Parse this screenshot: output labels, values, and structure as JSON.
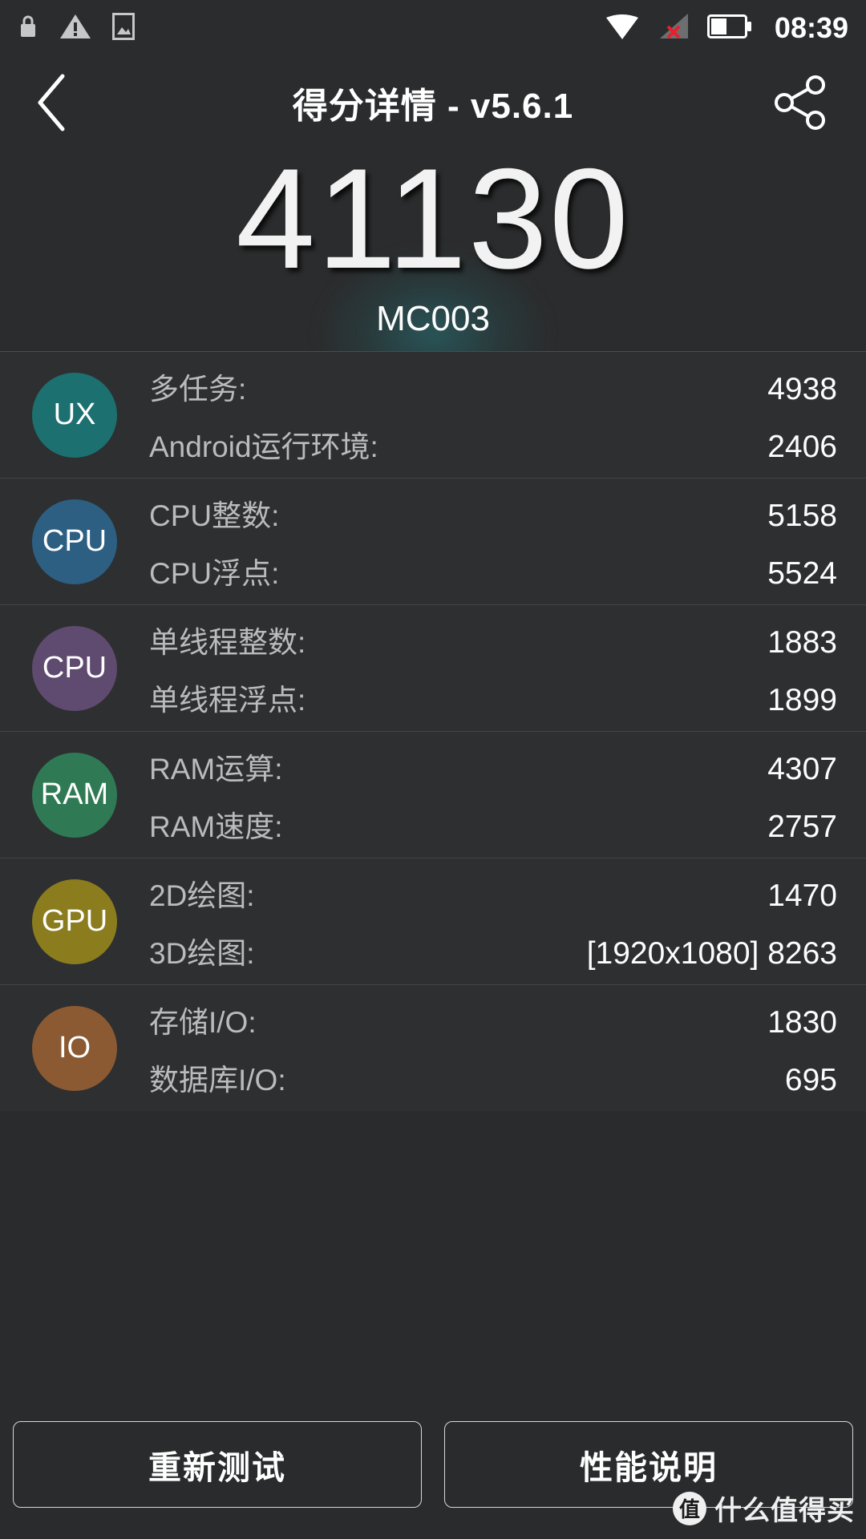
{
  "status_bar": {
    "time": "08:39",
    "left_icons": [
      {
        "name": "lock-icon",
        "glyph": "lock"
      },
      {
        "name": "warning-icon",
        "glyph": "warning-triangle"
      },
      {
        "name": "screenshot-icon",
        "glyph": "image"
      }
    ],
    "right_icons": [
      {
        "name": "wifi-icon",
        "glyph": "wifi"
      },
      {
        "name": "mobile-signal-off-icon",
        "glyph": "signal-x"
      },
      {
        "name": "battery-icon",
        "glyph": "battery-half"
      }
    ]
  },
  "action_bar": {
    "back_label": "back",
    "title": "得分详情 - v5.6.1",
    "share_label": "share"
  },
  "hero": {
    "total_score": "41130",
    "device_name": "MC003",
    "glow_color": "#28787d"
  },
  "scores": [
    {
      "badge": "UX",
      "badge_color": "#1d7070",
      "metrics": [
        {
          "label": "多任务:",
          "value": "4938"
        },
        {
          "label": "Android运行环境:",
          "value": "2406"
        }
      ]
    },
    {
      "badge": "CPU",
      "badge_color": "#2c5f82",
      "metrics": [
        {
          "label": "CPU整数:",
          "value": "5158"
        },
        {
          "label": "CPU浮点:",
          "value": "5524"
        }
      ]
    },
    {
      "badge": "CPU",
      "badge_color": "#5f4a70",
      "metrics": [
        {
          "label": "单线程整数:",
          "value": "1883"
        },
        {
          "label": "单线程浮点:",
          "value": "1899"
        }
      ]
    },
    {
      "badge": "RAM",
      "badge_color": "#2f7a55",
      "metrics": [
        {
          "label": "RAM运算:",
          "value": "4307"
        },
        {
          "label": "RAM速度:",
          "value": "2757"
        }
      ]
    },
    {
      "badge": "GPU",
      "badge_color": "#8b7c1e",
      "metrics": [
        {
          "label": "2D绘图:",
          "value": "1470"
        },
        {
          "label": "3D绘图:",
          "value": "[1920x1080] 8263"
        }
      ]
    },
    {
      "badge": "IO",
      "badge_color": "#8b5a32",
      "metrics": [
        {
          "label": "存储I/O:",
          "value": "1830"
        },
        {
          "label": "数据库I/O:",
          "value": "695"
        }
      ]
    }
  ],
  "footer": {
    "retest_label": "重新测试",
    "performance_label": "性能说明"
  },
  "watermark": {
    "logo": "值",
    "text": "什么值得买"
  }
}
